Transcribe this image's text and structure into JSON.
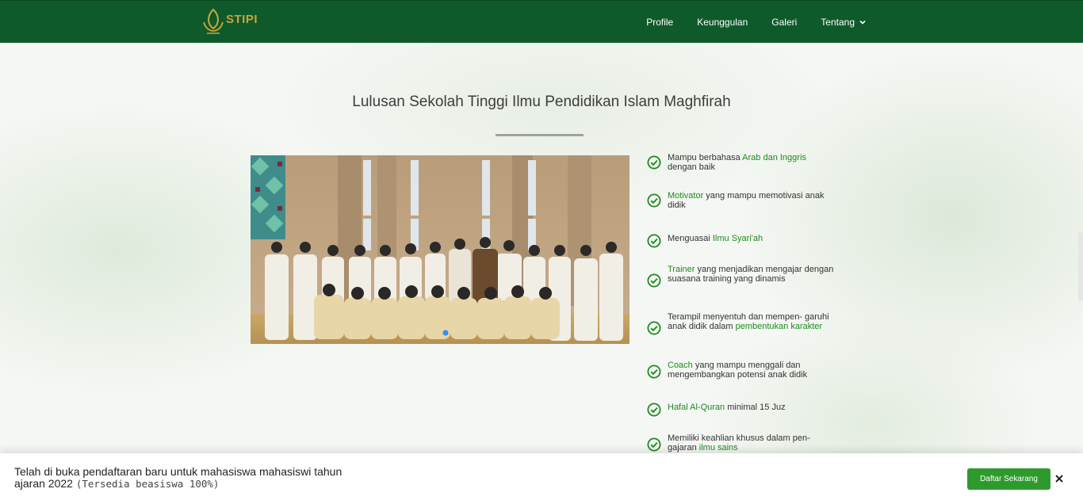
{
  "brand": {
    "logo_text": "STIPI",
    "accent_color": "#c9a63a",
    "nav_bg": "#0f5a2b"
  },
  "nav": {
    "items": [
      {
        "label": "Profile"
      },
      {
        "label": "Keunggulan"
      },
      {
        "label": "Galeri"
      },
      {
        "label": "Tentang",
        "icon": "chevron-down-icon"
      }
    ]
  },
  "section": {
    "title": "Lulusan Sekolah Tinggi Ilmu Pendidikan Islam Maghfirah"
  },
  "features": [
    {
      "pre": "Mampu berbahasa ",
      "hl": "Arab dan Inggris",
      "post": " dengan baik"
    },
    {
      "pre": "",
      "hl": "Motivator",
      "post": " yang mampu memotivasi anak didik"
    },
    {
      "pre": "Menguasai ",
      "hl": "Ilmu Syari'ah",
      "post": ""
    },
    {
      "pre": "",
      "hl": "Trainer",
      "post": " yang menjadikan mengajar dengan suasana training yang dinamis"
    },
    {
      "pre": "Terampil menyentuh dan mempen- garuhi anak didik dalam ",
      "hl": "pembentukan karakter",
      "post": ""
    },
    {
      "pre": "",
      "hl": "Coach",
      "post": " yang mampu menggali dan mengembangkan potensi anak didik"
    },
    {
      "pre": "",
      "hl": "Hafal Al-Quran",
      "post": " minimal 15 Juz"
    },
    {
      "pre": "Memiliki keahlian khusus dalam pen- gajaran ",
      "hl": "ilmu sains",
      "post": ""
    }
  ],
  "banner": {
    "text": "Telah di buka pendaftaran baru untuk mahasiswa mahasiswi tahun ajaran 2022",
    "extra": "(Tersedia beasiswa 100%)",
    "cta_label": "Daftar Sekarang",
    "close_icon": "close-icon",
    "cta_color": "#2e9a2e"
  },
  "colors": {
    "highlight": "#1f8a1f",
    "check": "#1f8a1f"
  }
}
